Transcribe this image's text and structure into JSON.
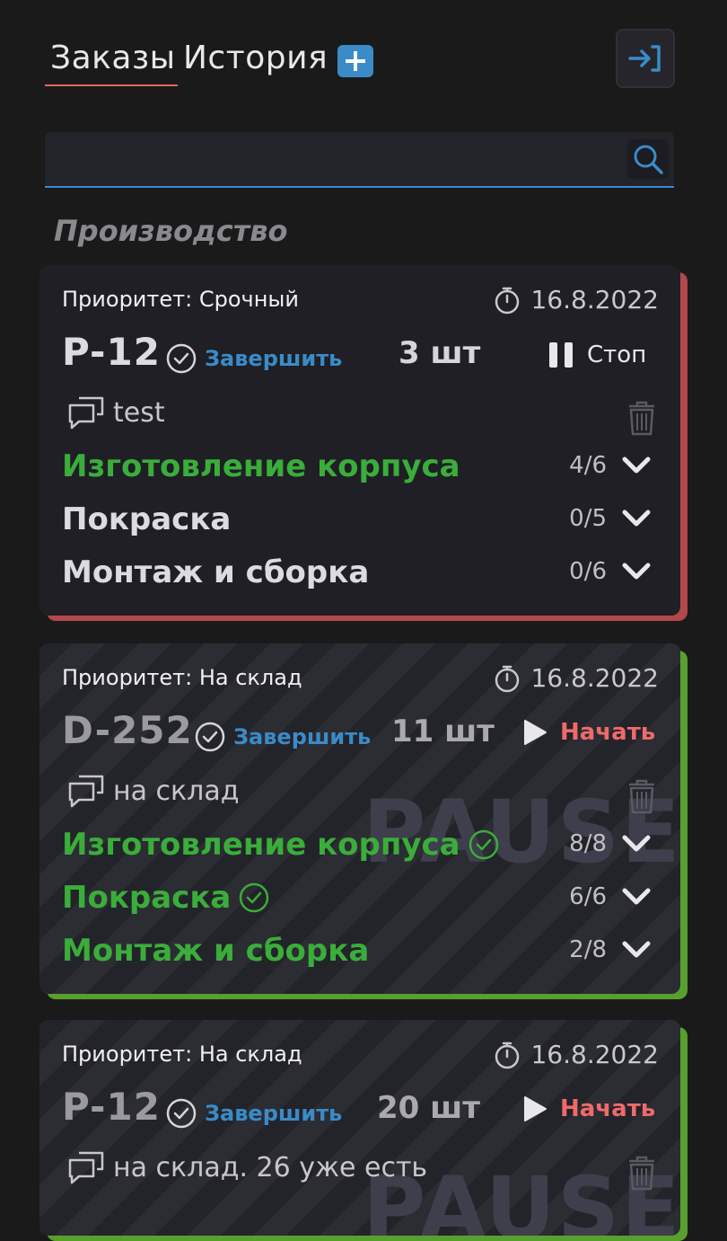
{
  "header": {
    "tabs": [
      {
        "label": "Заказы",
        "active": true
      },
      {
        "label": "История",
        "active": false
      }
    ],
    "add_icon": "plus-icon",
    "exit_icon": "exit-icon"
  },
  "search": {
    "value": "",
    "placeholder": "",
    "icon": "search-icon"
  },
  "section_title": "Производство",
  "colors": {
    "accent_blue": "#3a8bc7",
    "urgent": "#b3474a",
    "warehouse": "#58a02e",
    "done_green": "#3aad3a",
    "start_red": "#ef6a6a"
  },
  "orders": [
    {
      "priority": "Приоритет: Срочный",
      "date": "16.8.2022",
      "code": "P-12",
      "finish_label": "Завершить",
      "quantity": "3 шт",
      "action_label": "Стоп",
      "action_icon": "pause-icon",
      "comment": "test",
      "paused": false,
      "stages": [
        {
          "name": "Изготовление корпуса",
          "count": "4/6",
          "done": true,
          "check": false
        },
        {
          "name": "Покраска",
          "count": "0/5",
          "done": false,
          "check": false
        },
        {
          "name": "Монтаж и сборка",
          "count": "0/6",
          "done": false,
          "check": false
        }
      ]
    },
    {
      "priority": "Приоритет: На склад",
      "date": "16.8.2022",
      "code": "D-252",
      "finish_label": "Завершить",
      "quantity": "11 шт",
      "action_label": "Начать",
      "action_icon": "play-icon",
      "comment": "на склад",
      "paused": true,
      "watermark": "PAUSE",
      "stages": [
        {
          "name": "Изготовление корпуса",
          "count": "8/8",
          "done": true,
          "check": true
        },
        {
          "name": "Покраска",
          "count": "6/6",
          "done": true,
          "check": true
        },
        {
          "name": "Монтаж и сборка",
          "count": "2/8",
          "done": true,
          "check": false
        }
      ]
    },
    {
      "priority": "Приоритет: На склад",
      "date": "16.8.2022",
      "code": "P-12",
      "finish_label": "Завершить",
      "quantity": "20 шт",
      "action_label": "Начать",
      "action_icon": "play-icon",
      "comment": "на склад. 26 уже есть",
      "paused": true,
      "watermark": "PAUSE",
      "stages": []
    }
  ]
}
